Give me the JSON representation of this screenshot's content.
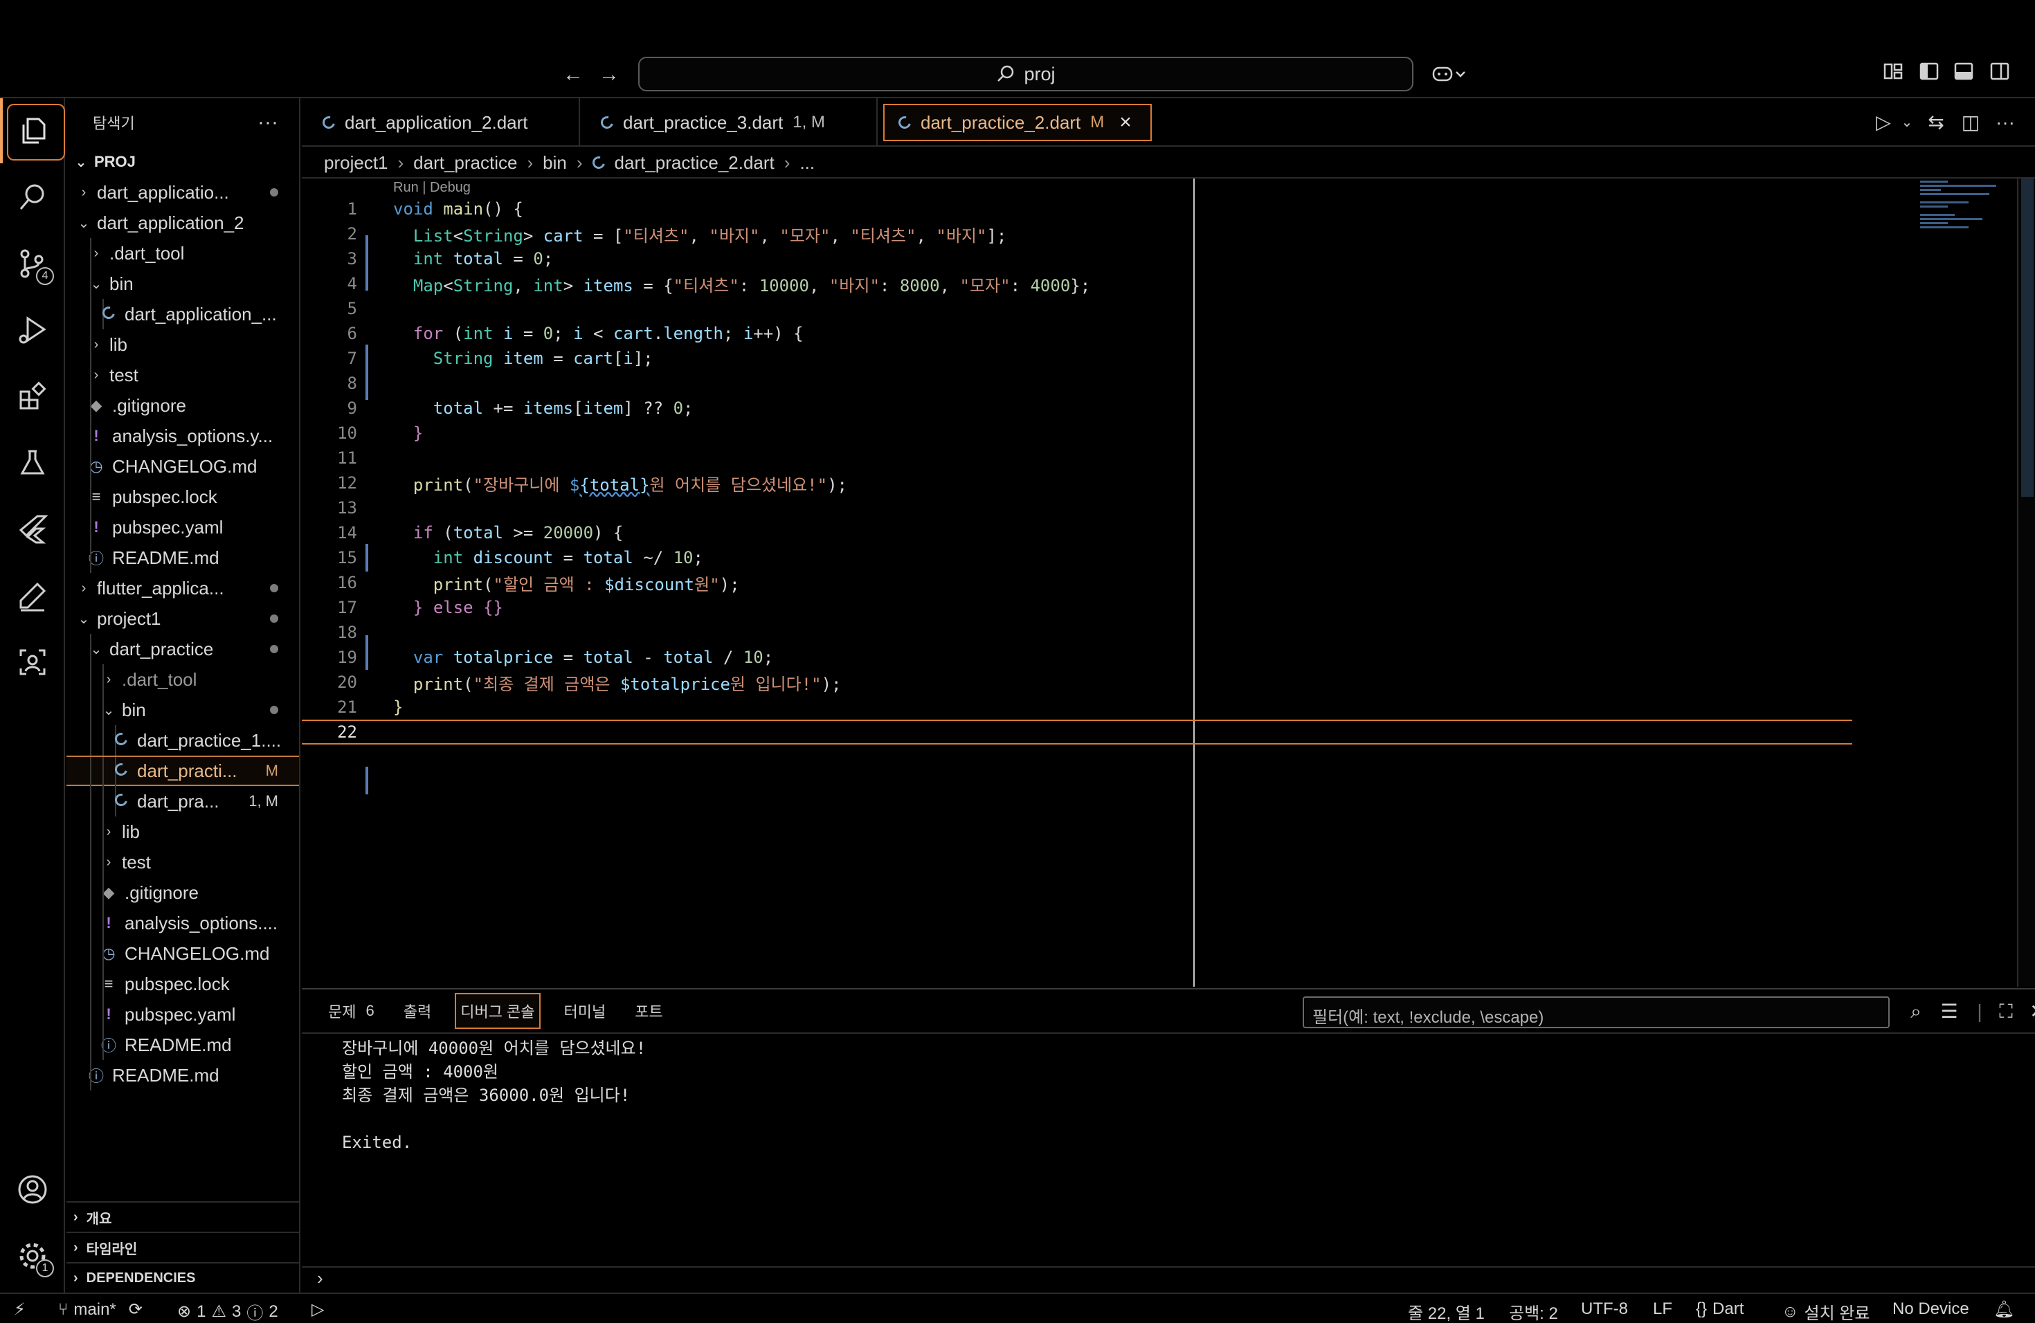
{
  "search": {
    "text": "proj"
  },
  "explorer": {
    "title": "탐색기",
    "root": "PROJ",
    "items": [
      {
        "label": "dart_applicatio...",
        "depth": 0,
        "chevron": "›",
        "dot": true
      },
      {
        "label": "dart_application_2",
        "depth": 0,
        "chevron": "⌄"
      },
      {
        "label": ".dart_tool",
        "depth": 1,
        "chevron": "›"
      },
      {
        "label": "bin",
        "depth": 1,
        "chevron": "⌄"
      },
      {
        "label": "dart_application_...",
        "depth": 2,
        "icon": "dart"
      },
      {
        "label": "lib",
        "depth": 1,
        "chevron": "›"
      },
      {
        "label": "test",
        "depth": 1,
        "chevron": "›"
      },
      {
        "label": ".gitignore",
        "depth": 1,
        "icon": "git"
      },
      {
        "label": "analysis_options.y...",
        "depth": 1,
        "icon": "yaml"
      },
      {
        "label": "CHANGELOG.md",
        "depth": 1,
        "icon": "clock"
      },
      {
        "label": "pubspec.lock",
        "depth": 1,
        "icon": "lines"
      },
      {
        "label": "pubspec.yaml",
        "depth": 1,
        "icon": "yaml"
      },
      {
        "label": "README.md",
        "depth": 1,
        "icon": "info"
      },
      {
        "label": "flutter_applica...",
        "depth": 0,
        "chevron": "›",
        "dot": true
      },
      {
        "label": "project1",
        "depth": 0,
        "chevron": "⌄",
        "dot": true
      },
      {
        "label": "dart_practice",
        "depth": 1,
        "chevron": "⌄",
        "dot": true
      },
      {
        "label": ".dart_tool",
        "depth": 2,
        "chevron": "›",
        "dim": true
      },
      {
        "label": "bin",
        "depth": 2,
        "chevron": "⌄",
        "dot": true
      },
      {
        "label": "dart_practice_1....",
        "depth": 3,
        "icon": "dart"
      },
      {
        "label": "dart_practi...",
        "depth": 3,
        "icon": "dart",
        "badge": "M",
        "selected": true
      },
      {
        "label": "dart_pra...",
        "depth": 3,
        "icon": "dart",
        "badge": "1, M"
      },
      {
        "label": "lib",
        "depth": 2,
        "chevron": "›"
      },
      {
        "label": "test",
        "depth": 2,
        "chevron": "›"
      },
      {
        "label": ".gitignore",
        "depth": 2,
        "icon": "git"
      },
      {
        "label": "analysis_options....",
        "depth": 2,
        "icon": "yaml"
      },
      {
        "label": "CHANGELOG.md",
        "depth": 2,
        "icon": "clock"
      },
      {
        "label": "pubspec.lock",
        "depth": 2,
        "icon": "lines"
      },
      {
        "label": "pubspec.yaml",
        "depth": 2,
        "icon": "yaml"
      },
      {
        "label": "README.md",
        "depth": 2,
        "icon": "info"
      },
      {
        "label": "README.md",
        "depth": 1,
        "icon": "info"
      }
    ],
    "sections": [
      "개요",
      "타임라인",
      "DEPENDENCIES"
    ]
  },
  "tabs": [
    {
      "label": "dart_application_2.dart",
      "mod": ""
    },
    {
      "label": "dart_practice_3.dart",
      "mod": "1, M"
    },
    {
      "label": "dart_practice_2.dart",
      "mod": "M",
      "active": true
    }
  ],
  "breadcrumb": [
    "project1",
    "dart_practice",
    "bin",
    "dart_practice_2.dart",
    "..."
  ],
  "editor": {
    "codelens": "Run | Debug",
    "current_line": 22
  },
  "panel": {
    "tabs": [
      {
        "label": "문제",
        "count": "6"
      },
      {
        "label": "출력"
      },
      {
        "label": "디버그 콘솔",
        "active": true
      },
      {
        "label": "터미널"
      },
      {
        "label": "포트"
      }
    ],
    "filter_placeholder": "필터(예: text, !exclude, \\escape)",
    "console": "장바구니에 40000원 어치를 담으셨네요!\n할인 금액 : 4000원\n최종 결제 금액은 36000.0원 입니다!\n\nExited."
  },
  "statusbar": {
    "branch": "main*",
    "errors": "1",
    "warnings": "3",
    "infos": "2",
    "position": "줄 22, 열 1",
    "spaces": "공백: 2",
    "encoding": "UTF-8",
    "eol": "LF",
    "language": "Dart",
    "install": "설치 완료",
    "device": "No Device"
  },
  "activity_badges": {
    "source_control": "4",
    "settings": "1"
  },
  "colors": {
    "accent": "#d97a33",
    "background": "#000000"
  }
}
